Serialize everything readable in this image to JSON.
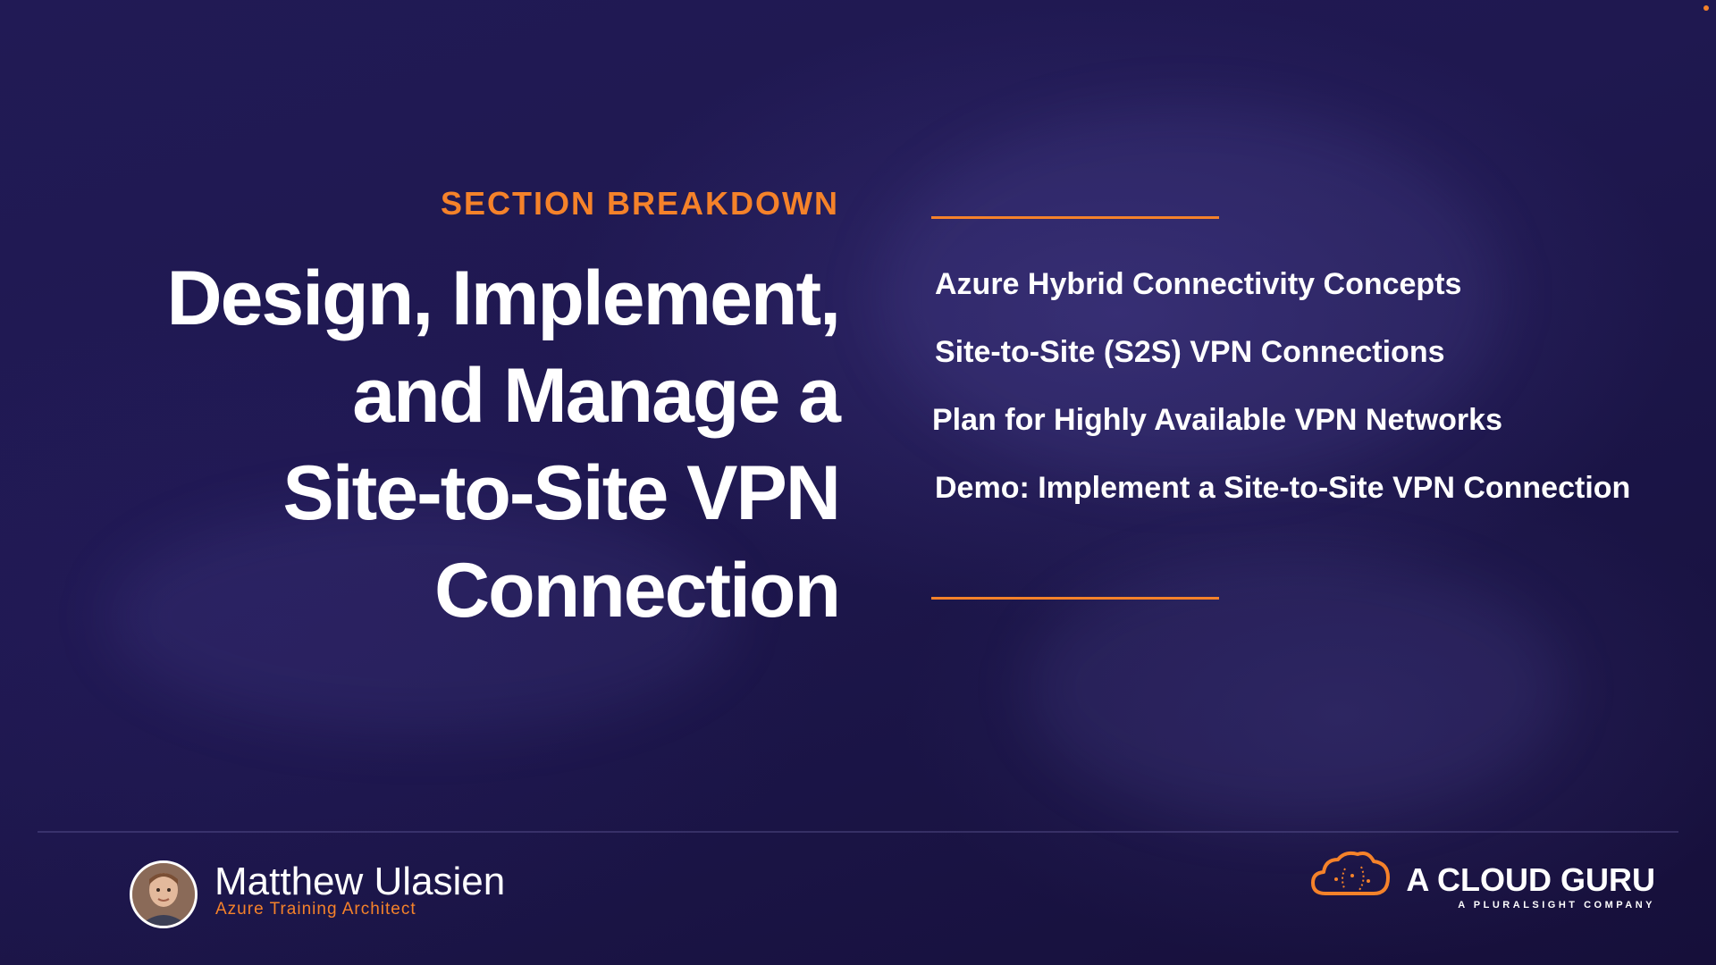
{
  "slide": {
    "kicker": "SECTION BREAKDOWN",
    "title_lines": [
      "Design, Implement,",
      "and Manage a",
      "Site-to-Site VPN",
      "Connection"
    ],
    "topics": [
      "Azure Hybrid Connectivity Concepts",
      "Site-to-Site (S2S) VPN Connections",
      "Plan for Highly Available VPN Networks",
      "Demo: Implement a Site-to-Site VPN Connection"
    ]
  },
  "presenter": {
    "name": "Matthew Ulasien",
    "role": "Azure Training Architect",
    "avatar_icon": "presenter-avatar"
  },
  "brand": {
    "name": "A CLOUD GURU",
    "tagline": "A PLURALSIGHT COMPANY",
    "logo_icon": "cloud-logo-icon"
  },
  "colors": {
    "accent": "#f5822a",
    "background": "#1f1850",
    "text": "#ffffff"
  }
}
